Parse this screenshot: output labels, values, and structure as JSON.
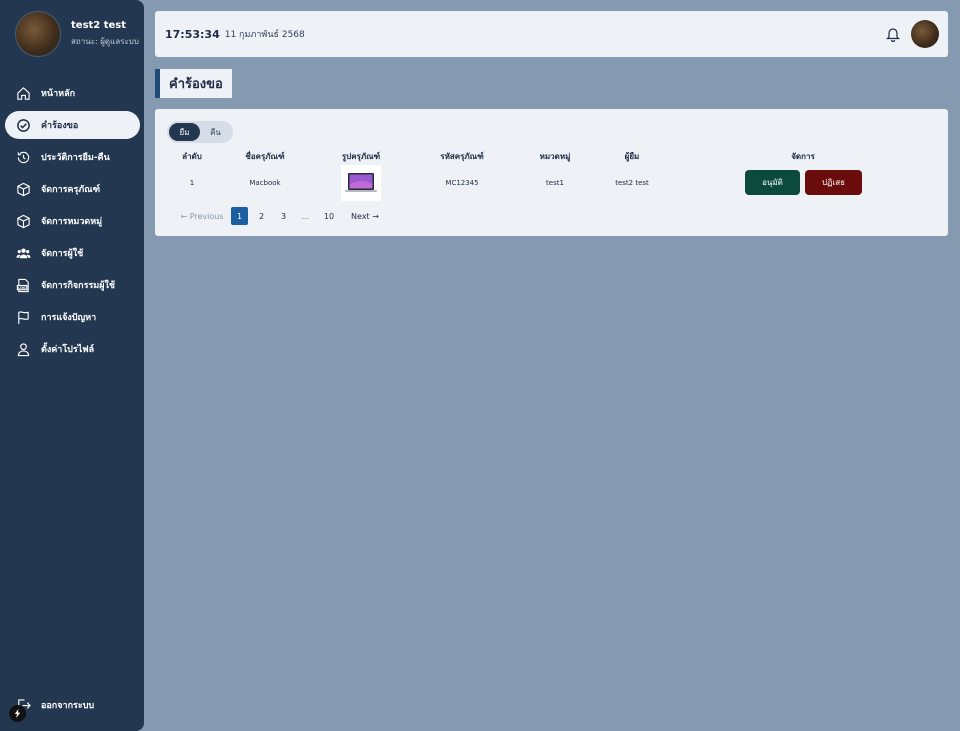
{
  "user": {
    "name": "test2 test",
    "status": "สถานะ: ผู้ดูแลระบบ"
  },
  "nav": [
    {
      "label": "หน้าหลัก",
      "icon": "home-icon"
    },
    {
      "label": "คำร้องขอ",
      "icon": "check-circle-icon",
      "active": true
    },
    {
      "label": "ประวัติการยืม-คืน",
      "icon": "history-icon"
    },
    {
      "label": "จัดการครุภัณฑ์",
      "icon": "box-icon"
    },
    {
      "label": "จัดการหมวดหมู่",
      "icon": "box-icon"
    },
    {
      "label": "จัดการผู้ใช้",
      "icon": "users-icon"
    },
    {
      "label": "จัดการกิจกรรมผู้ใช้",
      "icon": "log-icon"
    },
    {
      "label": "การแจ้งปัญหา",
      "icon": "flag-icon"
    },
    {
      "label": "ตั้งค่าโปรไฟล์",
      "icon": "profile-icon"
    }
  ],
  "logout_label": "ออกจากระบบ",
  "topbar": {
    "time": "17:53:34",
    "date": "11 กุมภาพันธ์ 2568"
  },
  "page_title": "คำร้องขอ",
  "tabs": {
    "borrow": "ยืม",
    "return": "คืน"
  },
  "table": {
    "headers": [
      "ลำดับ",
      "ชื่อครุภัณฑ์",
      "รูปครุภัณฑ์",
      "รหัสครุภัณฑ์",
      "หมวดหมู่",
      "ผู้ยืม",
      "จัดการ"
    ],
    "rows": [
      {
        "no": "1",
        "name": "Macbook",
        "code": "MC12345",
        "category": "test1",
        "borrower": "test2 test"
      }
    ],
    "approve_label": "อนุมัติ",
    "reject_label": "ปฏิเสธ"
  },
  "pagination": {
    "prev": "← Previous",
    "pages": [
      "1",
      "2",
      "3",
      "...",
      "10"
    ],
    "next": "Next →"
  }
}
